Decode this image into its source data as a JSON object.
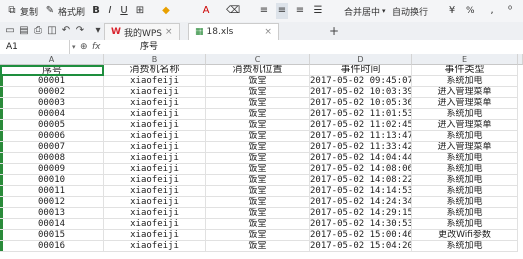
{
  "toolbar": {
    "copy_label": "复制",
    "format_painter_label": "格式刷",
    "merge_center_label": "合并居中",
    "auto_wrap_label": "自动换行",
    "percent_symbol": "%"
  },
  "tabs": [
    {
      "label": "我的WPS"
    },
    {
      "label": "18.xls"
    }
  ],
  "formula_bar": {
    "name_box": "A1",
    "fx": "fx",
    "value": "序号"
  },
  "columns": [
    "A",
    "B",
    "C",
    "D",
    "E"
  ],
  "table": {
    "headers": [
      "序号",
      "消费机名称",
      "消费机位置",
      "事件时间",
      "事件类型"
    ],
    "rows": [
      [
        "00001",
        "xiaofeiji",
        "饭堂",
        "2017-05-02 09:45:07",
        "系统加电"
      ],
      [
        "00002",
        "xiaofeiji",
        "饭堂",
        "2017-05-02 10:03:39",
        "进入管理菜单"
      ],
      [
        "00003",
        "xiaofeiji",
        "饭堂",
        "2017-05-02 10:05:36",
        "进入管理菜单"
      ],
      [
        "00004",
        "xiaofeiji",
        "饭堂",
        "2017-05-02 11:01:53",
        "系统加电"
      ],
      [
        "00005",
        "xiaofeiji",
        "饭堂",
        "2017-05-02 11:02:45",
        "进入管理菜单"
      ],
      [
        "00006",
        "xiaofeiji",
        "饭堂",
        "2017-05-02 11:13:47",
        "系统加电"
      ],
      [
        "00007",
        "xiaofeiji",
        "饭堂",
        "2017-05-02 11:33:42",
        "进入管理菜单"
      ],
      [
        "00008",
        "xiaofeiji",
        "饭堂",
        "2017-05-02 14:04:44",
        "系统加电"
      ],
      [
        "00009",
        "xiaofeiji",
        "饭堂",
        "2017-05-02 14:08:06",
        "系统加电"
      ],
      [
        "00010",
        "xiaofeiji",
        "饭堂",
        "2017-05-02 14:08:22",
        "系统加电"
      ],
      [
        "00011",
        "xiaofeiji",
        "饭堂",
        "2017-05-02 14:14:53",
        "系统加电"
      ],
      [
        "00012",
        "xiaofeiji",
        "饭堂",
        "2017-05-02 14:24:34",
        "系统加电"
      ],
      [
        "00013",
        "xiaofeiji",
        "饭堂",
        "2017-05-02 14:29:15",
        "系统加电"
      ],
      [
        "00014",
        "xiaofeiji",
        "饭堂",
        "2017-05-02 14:30:53",
        "系统加电"
      ],
      [
        "00015",
        "xiaofeiji",
        "饭堂",
        "2017-05-02 15:00:46",
        "更改Wifi参数"
      ],
      [
        "00016",
        "xiaofeiji",
        "饭堂",
        "2017-05-02 15:04:20",
        "系统加电"
      ]
    ]
  },
  "colors": {
    "selection": "#1e8e3e",
    "header_bg": "#eceff3",
    "ribbon_bg": "#f4f5f7"
  }
}
